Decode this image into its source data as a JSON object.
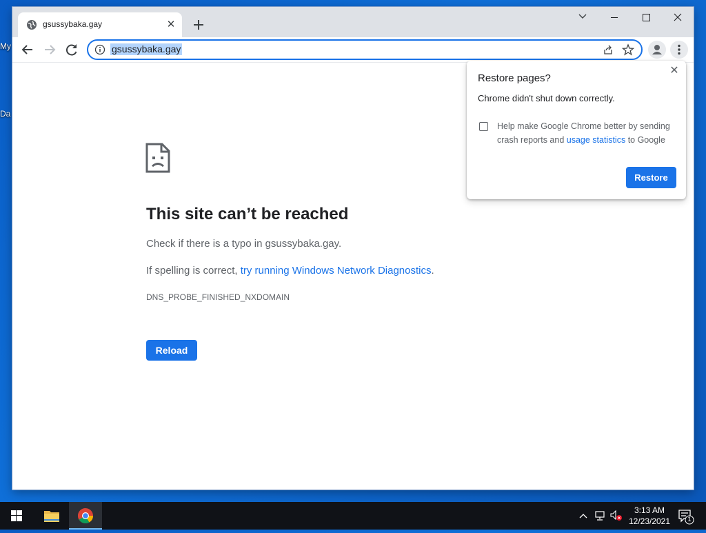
{
  "desktop": {
    "icon_labels": [
      "My",
      "Da"
    ]
  },
  "browser": {
    "tab": {
      "title": "gsussybaka.gay",
      "favicon": "globe-icon"
    },
    "url": "gsussybaka.gay",
    "new_tab_label": "+"
  },
  "error_page": {
    "icon": "sad-page-icon",
    "title": "This site can’t be reached",
    "line1": "Check if there is a typo in gsussybaka.gay.",
    "line2_prefix": "If spelling is correct, ",
    "line2_link": "try running Windows Network Diagnostics",
    "line2_suffix": ".",
    "error_code": "DNS_PROBE_FINISHED_NXDOMAIN",
    "reload_label": "Reload"
  },
  "restore_popup": {
    "title": "Restore pages?",
    "message": "Chrome didn't shut down correctly.",
    "checkbox_text_prefix": "Help make Google Chrome better by sending crash reports and ",
    "checkbox_link": "usage statistics",
    "checkbox_text_suffix": " to Google",
    "checkbox_checked": false,
    "restore_label": "Restore"
  },
  "taskbar": {
    "time": "3:13 AM",
    "date": "12/23/2021",
    "notification_count": "1",
    "pinned": [
      "start-icon",
      "file-explorer-icon",
      "chrome-icon"
    ]
  },
  "colors": {
    "accent": "#1a73e8",
    "desktop": "#0f6fd8",
    "taskbar": "#101217"
  }
}
